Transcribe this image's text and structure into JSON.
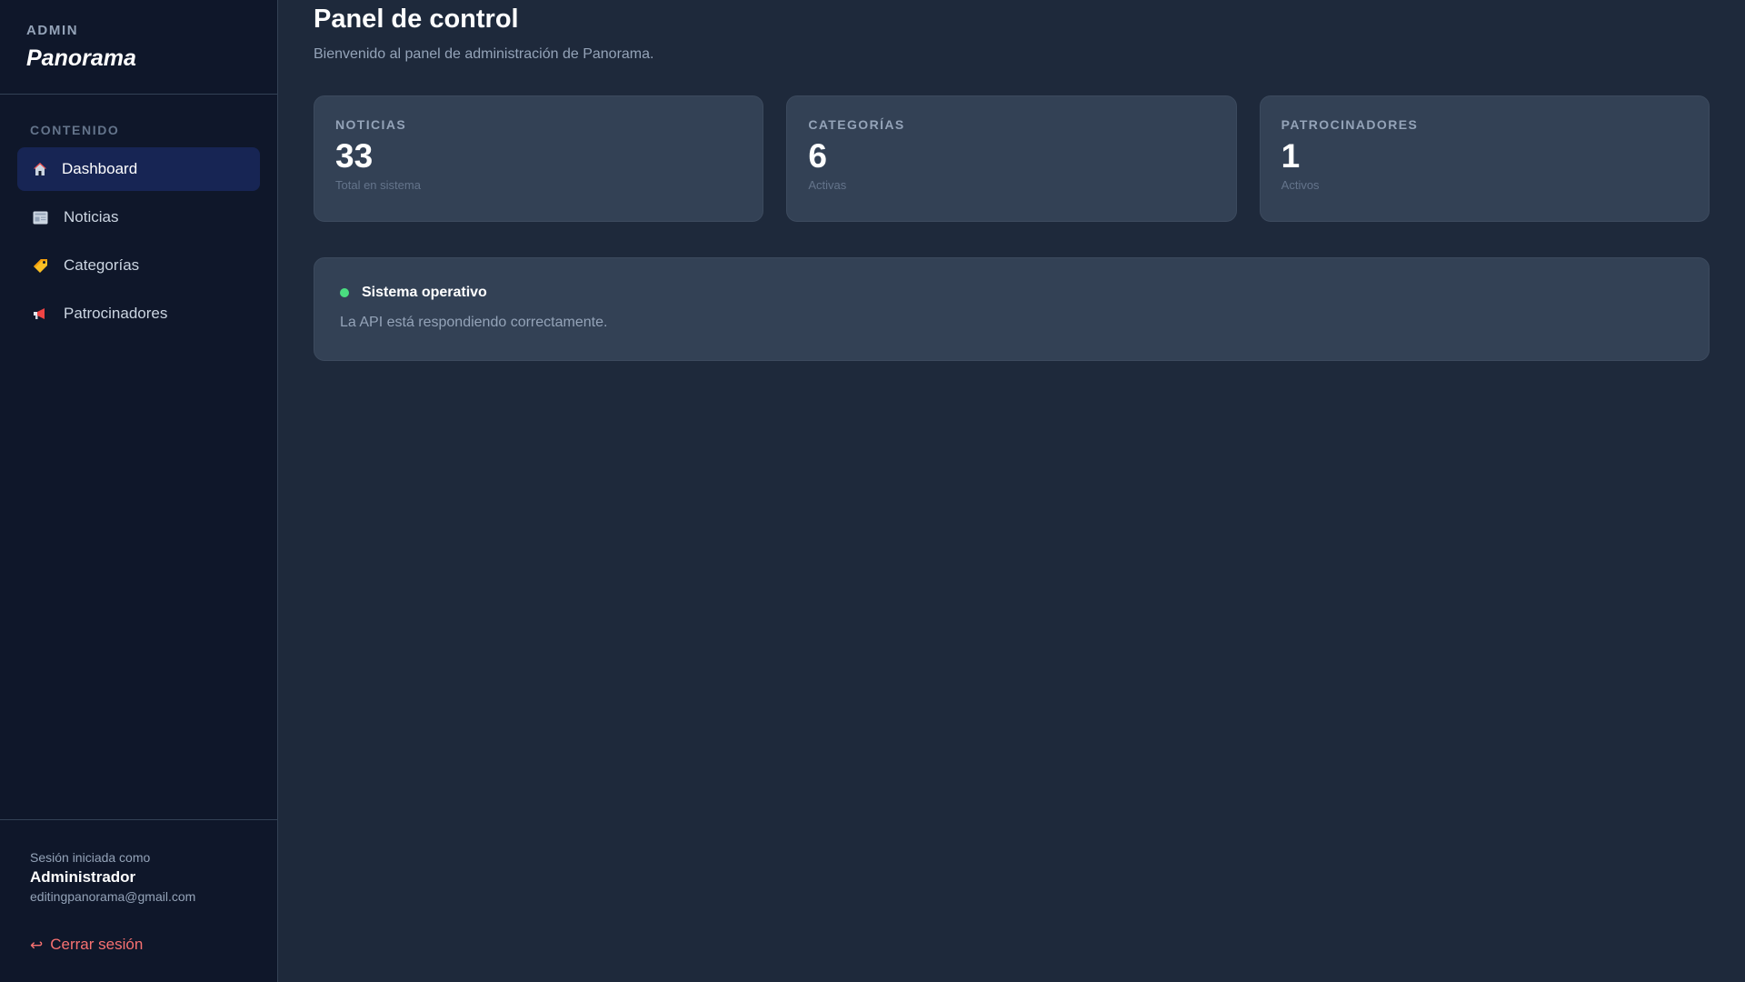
{
  "sidebar": {
    "brand_sub": "ADMIN",
    "brand_name": "Panorama",
    "section_label": "CONTENIDO",
    "items": [
      {
        "label": "Dashboard",
        "icon": "home-icon",
        "active": true
      },
      {
        "label": "Noticias",
        "icon": "newspaper-icon",
        "active": false
      },
      {
        "label": "Categorías",
        "icon": "tag-icon",
        "active": false
      },
      {
        "label": "Patrocinadores",
        "icon": "megaphone-icon",
        "active": false
      }
    ],
    "footer": {
      "session_label": "Sesión iniciada como",
      "user": "Administrador",
      "email": "editingpanorama@gmail.com",
      "logout_label": "Cerrar sesión",
      "logout_icon": "logout-arrow-icon"
    }
  },
  "main": {
    "title": "Panel de control",
    "subtitle": "Bienvenido al panel de administración de Panorama.",
    "cards": [
      {
        "label": "NOTICIAS",
        "value": "33",
        "note": "Total en sistema"
      },
      {
        "label": "CATEGORÍAS",
        "value": "6",
        "note": "Activas"
      },
      {
        "label": "PATROCINADORES",
        "value": "1",
        "note": "Activos"
      }
    ],
    "status": {
      "title": "Sistema operativo",
      "text": "La API está respondiendo correctamente.",
      "color": "#4ade80"
    }
  },
  "colors": {
    "sidebar_bg": "#0f172a",
    "main_bg": "#1e293b",
    "card_bg": "#334155",
    "active_bg": "#172554",
    "logout": "#f87171"
  }
}
